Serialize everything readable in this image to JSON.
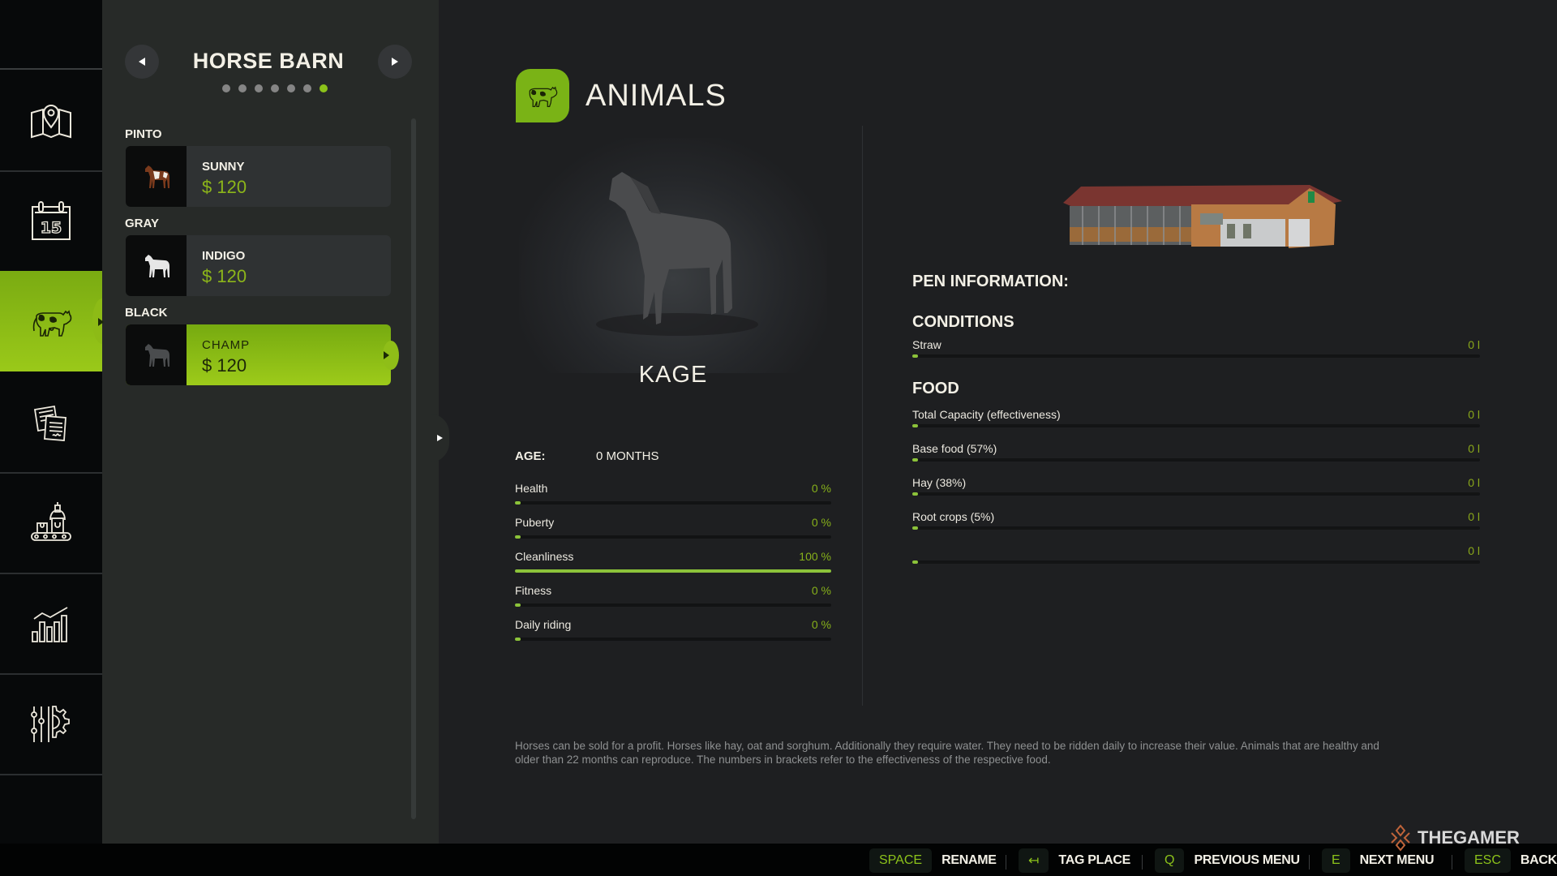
{
  "nav": {
    "items": [
      {
        "id": "map",
        "icon": "map-icon",
        "active": false
      },
      {
        "id": "calendar",
        "icon": "calendar-icon",
        "active": false,
        "day": "15"
      },
      {
        "id": "animals",
        "icon": "cow-icon",
        "active": true
      },
      {
        "id": "contracts",
        "icon": "contracts-icon",
        "active": false
      },
      {
        "id": "production",
        "icon": "production-icon",
        "active": false
      },
      {
        "id": "statistics",
        "icon": "statistics-icon",
        "active": false
      },
      {
        "id": "settings",
        "icon": "settings-icon",
        "active": false
      }
    ]
  },
  "list_panel": {
    "title": "HORSE BARN",
    "page_dots": {
      "count": 7,
      "active_index": 6
    },
    "groups": [
      {
        "label": "PINTO",
        "animals": [
          {
            "name": "SUNNY",
            "price": "$ 120",
            "coat": "pinto",
            "selected": false
          }
        ]
      },
      {
        "label": "GRAY",
        "animals": [
          {
            "name": "INDIGO",
            "price": "$ 120",
            "coat": "gray",
            "selected": false
          }
        ]
      },
      {
        "label": "BLACK",
        "animals": [
          {
            "name": "CHAMP",
            "price": "$ 120",
            "coat": "black",
            "selected": true
          }
        ]
      }
    ]
  },
  "main": {
    "section_title": "ANIMALS",
    "animal": {
      "name": "KAGE",
      "age_label": "AGE:",
      "age_value": "0 MONTHS",
      "stats": [
        {
          "label": "Health",
          "value": "0 %",
          "fraction": 0.0
        },
        {
          "label": "Puberty",
          "value": "0 %",
          "fraction": 0.0
        },
        {
          "label": "Cleanliness",
          "value": "100 %",
          "fraction": 1.0
        },
        {
          "label": "Fitness",
          "value": "0 %",
          "fraction": 0.0
        },
        {
          "label": "Daily riding",
          "value": "0 %",
          "fraction": 0.0
        }
      ]
    },
    "pen": {
      "title": "PEN INFORMATION:",
      "conditions_title": "CONDITIONS",
      "conditions": [
        {
          "label": "Straw",
          "value": "0 l",
          "fraction": 0.0
        }
      ],
      "food_title": "FOOD",
      "food": [
        {
          "label": "Total Capacity (effectiveness)",
          "value": "0 l",
          "fraction": 0.0
        },
        {
          "label": "Base food (57%)",
          "value": "0 l",
          "fraction": 0.0
        },
        {
          "label": "Hay (38%)",
          "value": "0 l",
          "fraction": 0.0
        },
        {
          "label": "Root crops (5%)",
          "value": "0 l",
          "fraction": 0.0
        },
        {
          "label": "",
          "value": "0 l",
          "fraction": 0.0
        }
      ]
    },
    "description": "Horses can be sold for a profit. Horses like hay, oat and sorghum. Additionally they require water. They need to be ridden daily to increase their value. Animals that are healthy and older than 22 months can reproduce. The numbers in brackets refer to the effectiveness of the respective food."
  },
  "bottom_bar": {
    "hints": [
      {
        "key": "SPACE",
        "action": "RENAME"
      },
      {
        "key": "↤",
        "action": "TAG PLACE"
      },
      {
        "key": "Q",
        "action": "PREVIOUS MENU"
      },
      {
        "key": "E",
        "action": "NEXT MENU"
      },
      {
        "key": "ESC",
        "action": "BACK"
      }
    ]
  },
  "watermark": "THEGAMER",
  "colors": {
    "accent": "#8cc21a",
    "nav_bg": "#07090a",
    "panel_bg": "#272a28",
    "main_bg": "#1e1f21",
    "price": "#8cb51a"
  }
}
